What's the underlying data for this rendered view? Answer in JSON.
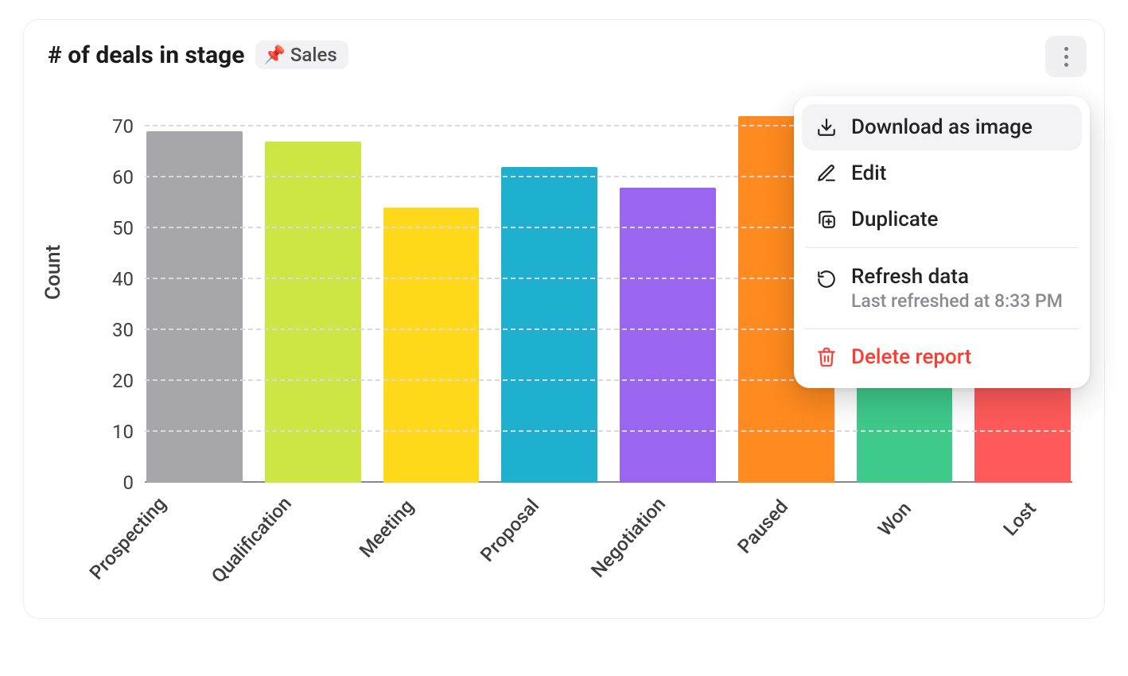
{
  "header": {
    "title": "# of deals in stage",
    "tag_label": "Sales",
    "tag_icon": "📌"
  },
  "chart_data": {
    "type": "bar",
    "title": "# of deals in stage",
    "xlabel": "",
    "ylabel": "Count",
    "ylim": [
      0,
      75
    ],
    "yticks": [
      0,
      10,
      20,
      30,
      40,
      50,
      60,
      70
    ],
    "categories": [
      "Prospecting",
      "Qualification",
      "Meeting",
      "Proposal",
      "Negotiation",
      "Paused",
      "Won",
      "Lost"
    ],
    "values": [
      69,
      67,
      54,
      62,
      58,
      72,
      27,
      27
    ],
    "colors": [
      "#a7a7ab",
      "#cde643",
      "#ffd91a",
      "#1fb0cf",
      "#9a66f0",
      "#ff8a1f",
      "#3fc98b",
      "#ff5a5a"
    ]
  },
  "menu": {
    "download": "Download as image",
    "edit": "Edit",
    "duplicate": "Duplicate",
    "refresh_title": "Refresh data",
    "refresh_sub": "Last refreshed at 8:33 PM",
    "delete": "Delete report"
  }
}
